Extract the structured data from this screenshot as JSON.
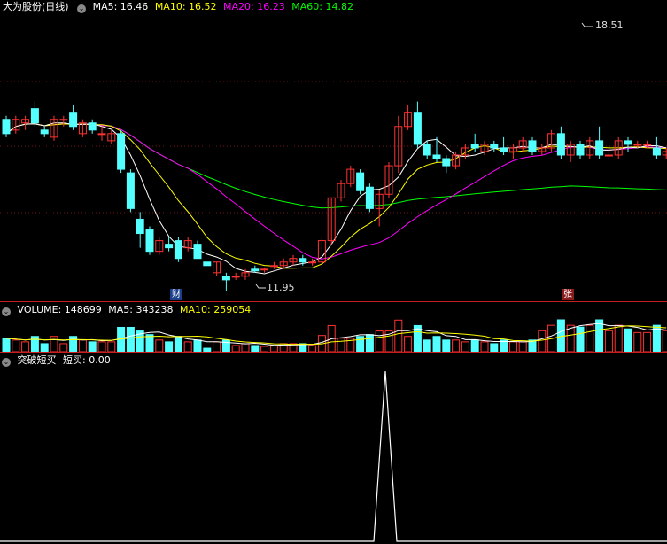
{
  "main": {
    "title": "大为股份(日线)",
    "ma_labels": [
      {
        "text": "MA5: 16.46",
        "color": "#ffffff"
      },
      {
        "text": "MA10: 16.52",
        "color": "#ffff00"
      },
      {
        "text": "MA20: 16.23",
        "color": "#ff00ff"
      },
      {
        "text": "MA60: 14.82",
        "color": "#00ff00"
      }
    ],
    "high_label": "18.51",
    "low_label": "11.95",
    "badge_cai": "财",
    "badge_zhang": "张"
  },
  "volume": {
    "label": "VOLUME: 148699",
    "ma5": "MA5: 343238",
    "ma10": "MA10: 259054"
  },
  "indicator": {
    "name": "突破短买",
    "value": "短买: 0.00"
  },
  "colors": {
    "up": "#ff3232",
    "down": "#54ffff",
    "ma5": "#ffffff",
    "ma10": "#ffff00",
    "ma20": "#ff00ff",
    "ma60": "#00ff00"
  },
  "candles": [
    [
      16.0,
      15.6,
      16.1,
      15.5
    ],
    [
      15.7,
      16.0,
      16.1,
      15.6
    ],
    [
      15.9,
      16.0,
      16.1,
      15.7
    ],
    [
      16.3,
      15.9,
      16.5,
      15.8
    ],
    [
      15.7,
      15.6,
      15.8,
      15.5
    ],
    [
      15.5,
      16.0,
      16.1,
      15.4
    ],
    [
      16.0,
      16.0,
      16.1,
      15.8
    ],
    [
      16.2,
      15.8,
      16.4,
      15.7
    ],
    [
      15.6,
      15.9,
      16.0,
      15.5
    ],
    [
      15.9,
      15.7,
      16.0,
      15.6
    ],
    [
      15.6,
      15.6,
      15.8,
      15.4
    ],
    [
      15.4,
      15.6,
      15.7,
      15.3
    ],
    [
      15.6,
      14.6,
      15.7,
      14.5
    ],
    [
      14.5,
      13.5,
      14.6,
      13.4
    ],
    [
      13.2,
      12.8,
      13.4,
      12.4
    ],
    [
      12.9,
      12.3,
      13.0,
      12.2
    ],
    [
      12.3,
      12.6,
      12.7,
      12.2
    ],
    [
      12.5,
      12.4,
      12.7,
      12.3
    ],
    [
      12.6,
      12.1,
      12.7,
      12.0
    ],
    [
      12.4,
      12.6,
      12.7,
      12.3
    ],
    [
      12.5,
      12.1,
      12.6,
      12.1
    ],
    [
      12.0,
      11.9,
      12.0,
      11.95
    ],
    [
      11.7,
      12.0,
      12.0,
      11.6
    ],
    [
      11.6,
      11.5,
      11.7,
      11.2
    ],
    [
      11.6,
      11.6,
      11.7,
      11.5
    ],
    [
      11.6,
      11.7,
      11.8,
      11.5
    ],
    [
      11.8,
      11.75,
      11.9,
      11.7
    ],
    [
      11.8,
      11.8,
      11.85,
      11.7
    ],
    [
      11.9,
      11.9,
      12.0,
      11.8
    ],
    [
      11.9,
      12.0,
      12.1,
      11.8
    ],
    [
      12.0,
      12.1,
      12.2,
      11.9
    ],
    [
      12.1,
      12.0,
      12.2,
      11.9
    ],
    [
      12.0,
      12.0,
      12.1,
      11.9
    ],
    [
      12.0,
      12.6,
      12.7,
      11.95
    ],
    [
      12.6,
      13.8,
      13.8,
      12.5
    ],
    [
      13.8,
      14.2,
      14.3,
      13.7
    ],
    [
      14.2,
      14.6,
      14.7,
      14.1
    ],
    [
      14.5,
      14.0,
      14.6,
      13.9
    ],
    [
      14.1,
      13.5,
      14.2,
      13.4
    ],
    [
      13.5,
      13.9,
      14.0,
      13.0
    ],
    [
      13.9,
      14.7,
      14.8,
      13.8
    ],
    [
      14.7,
      15.8,
      16.1,
      14.5
    ],
    [
      15.8,
      16.2,
      16.4,
      15.7
    ],
    [
      16.2,
      15.3,
      16.5,
      15.2
    ],
    [
      15.3,
      15.0,
      15.4,
      14.9
    ],
    [
      15.0,
      14.9,
      15.5,
      14.8
    ],
    [
      14.9,
      14.7,
      15.0,
      14.5
    ],
    [
      14.7,
      15.0,
      15.1,
      14.6
    ],
    [
      15.0,
      15.2,
      15.3,
      14.9
    ],
    [
      15.3,
      15.2,
      15.6,
      15.1
    ],
    [
      15.1,
      15.3,
      15.4,
      15.0
    ],
    [
      15.3,
      15.2,
      15.4,
      15.1
    ],
    [
      15.2,
      15.1,
      15.5,
      15.0
    ],
    [
      15.1,
      15.2,
      15.3,
      14.9
    ],
    [
      15.2,
      15.4,
      15.5,
      15.1
    ],
    [
      15.4,
      15.1,
      15.5,
      15.0
    ],
    [
      15.1,
      15.2,
      15.3,
      15.0
    ],
    [
      15.2,
      15.6,
      15.7,
      15.1
    ],
    [
      15.6,
      15.0,
      15.8,
      14.9
    ],
    [
      15.0,
      15.3,
      15.4,
      14.8
    ],
    [
      15.3,
      15.0,
      15.4,
      14.9
    ],
    [
      15.0,
      15.4,
      15.5,
      14.9
    ],
    [
      15.4,
      15.0,
      15.8,
      14.9
    ],
    [
      15.0,
      15.0,
      15.2,
      14.9
    ],
    [
      15.0,
      15.4,
      15.5,
      14.9
    ],
    [
      15.4,
      15.3,
      15.5,
      15.1
    ],
    [
      15.3,
      15.3,
      15.4,
      15.2
    ],
    [
      15.3,
      15.3,
      15.4,
      15.2
    ],
    [
      15.2,
      15.0,
      15.5,
      14.9
    ],
    [
      15.0,
      15.1,
      15.2,
      14.9
    ]
  ]
}
